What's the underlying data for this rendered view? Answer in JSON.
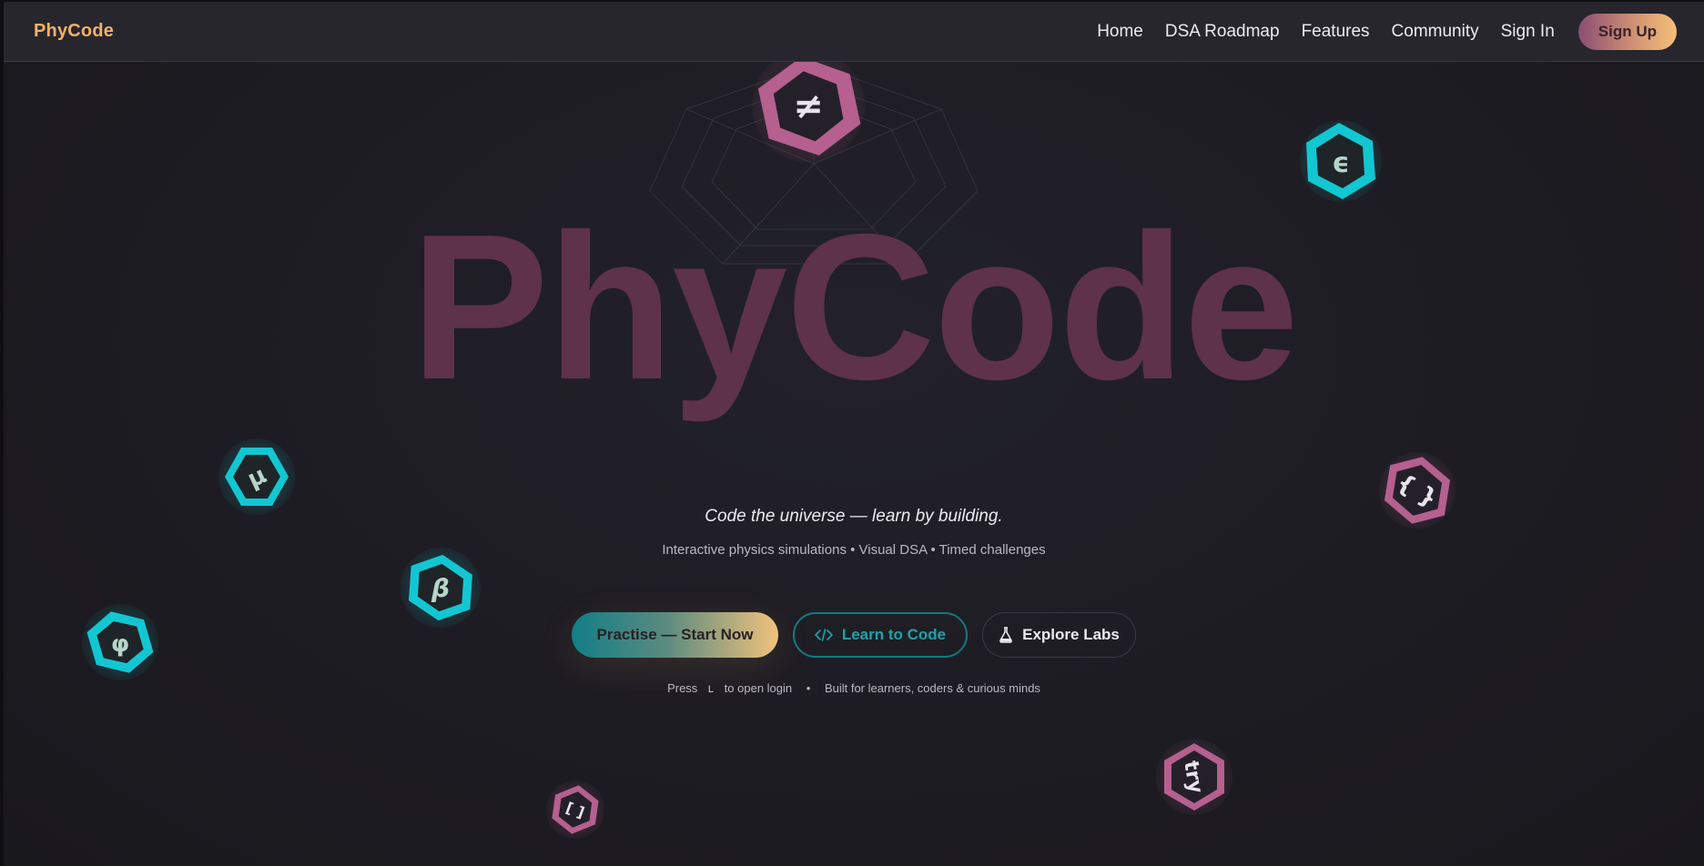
{
  "nav": {
    "logo": "PhyCode",
    "links": [
      "Home",
      "DSA Roadmap",
      "Features",
      "Community",
      "Sign In"
    ],
    "signup": "Sign Up"
  },
  "hero": {
    "title": "PhyCode",
    "tagline": "Code the universe — learn by building.",
    "subline": "Interactive physics simulations • Visual DSA • Timed challenges",
    "buttons": {
      "primary": "Practise — Start Now",
      "outline": "Learn to Code",
      "ghost": "Explore Labs"
    },
    "footnote": {
      "press": "Press",
      "key": "L",
      "after": "to open login",
      "sep": "•",
      "built": "Built for learners, coders & curious minds"
    }
  },
  "badges": [
    {
      "symbol": "≠",
      "style": "pink"
    },
    {
      "symbol": "ϵ",
      "style": "teal"
    },
    {
      "symbol": "μ",
      "style": "teal"
    },
    {
      "symbol": "β",
      "style": "teal"
    },
    {
      "symbol": "φ",
      "style": "teal"
    },
    {
      "symbol": "{ }",
      "style": "pink"
    },
    {
      "symbol": "try",
      "style": "pink"
    },
    {
      "symbol": "[ ]",
      "style": "pink"
    }
  ],
  "colors": {
    "accent_orange": "#f2b26b",
    "pink": "#b5608f",
    "teal": "#12c7d2",
    "title": "#5e3248"
  }
}
